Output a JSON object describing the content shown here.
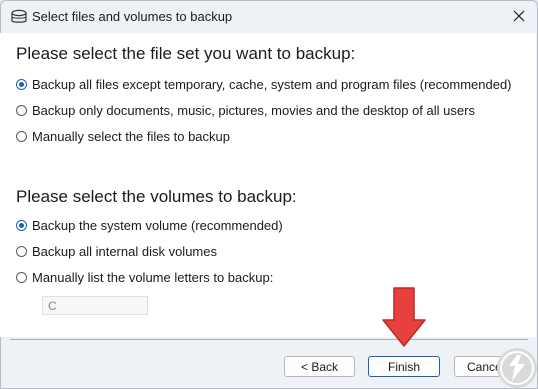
{
  "window": {
    "title": "Select files and volumes to backup",
    "icon": "drive-icon"
  },
  "fileset": {
    "heading": "Please select the file set you want to backup:",
    "options": [
      {
        "label": "Backup all files except temporary, cache, system and program files (recommended)",
        "checked": true
      },
      {
        "label": "Backup only documents, music, pictures, movies and the desktop of all users",
        "checked": false
      },
      {
        "label": "Manually select the files to backup",
        "checked": false
      }
    ]
  },
  "volumes": {
    "heading": "Please select the volumes to backup:",
    "options": [
      {
        "label": "Backup the system volume (recommended)",
        "checked": true
      },
      {
        "label": "Backup all internal disk volumes",
        "checked": false
      },
      {
        "label": "Manually list the volume letters to backup:",
        "checked": false
      }
    ],
    "letters_value": "C"
  },
  "buttons": {
    "back": "< Back",
    "finish": "Finish",
    "cancel": "Cancel"
  },
  "colors": {
    "accent": "#1d5fb4",
    "annotation_arrow": "#e8403f"
  }
}
